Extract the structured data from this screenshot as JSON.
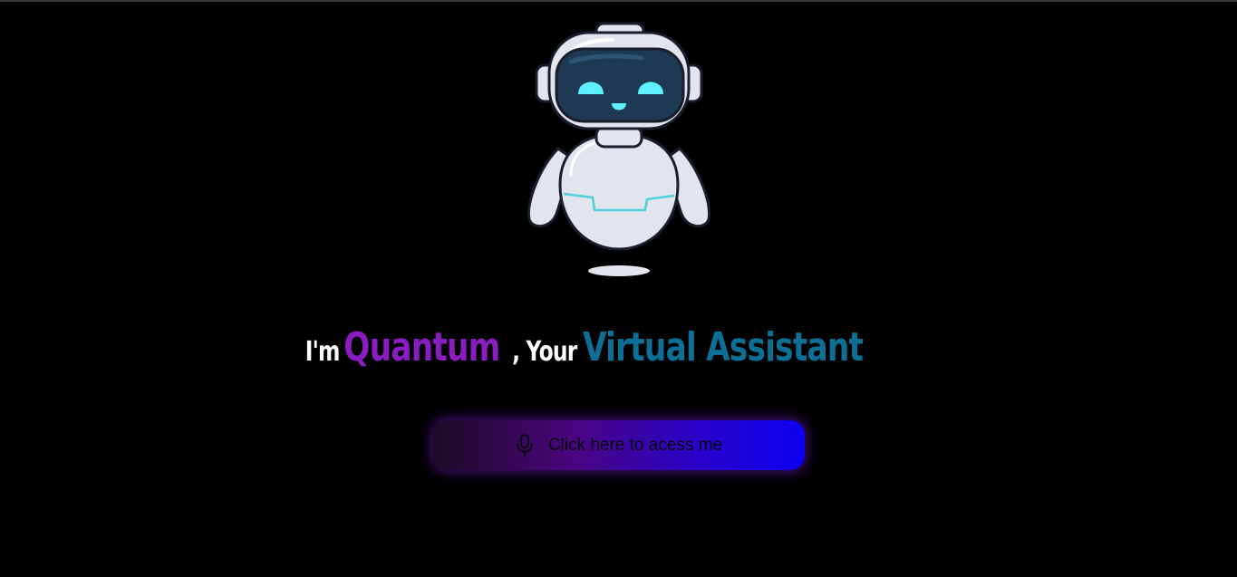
{
  "headline": {
    "intro": "I'm",
    "name": "Quantum",
    "connector": ", Your",
    "role": "Virtual Assistant"
  },
  "access_button": {
    "icon": "microphone-icon",
    "label": "Click here to acess me"
  },
  "colors": {
    "background": "#000000",
    "name_accent": "#8a1dc0",
    "role_accent": "#0e6f96",
    "button_gradient_start": "#1c0a22",
    "button_gradient_end": "#0b00f2"
  }
}
